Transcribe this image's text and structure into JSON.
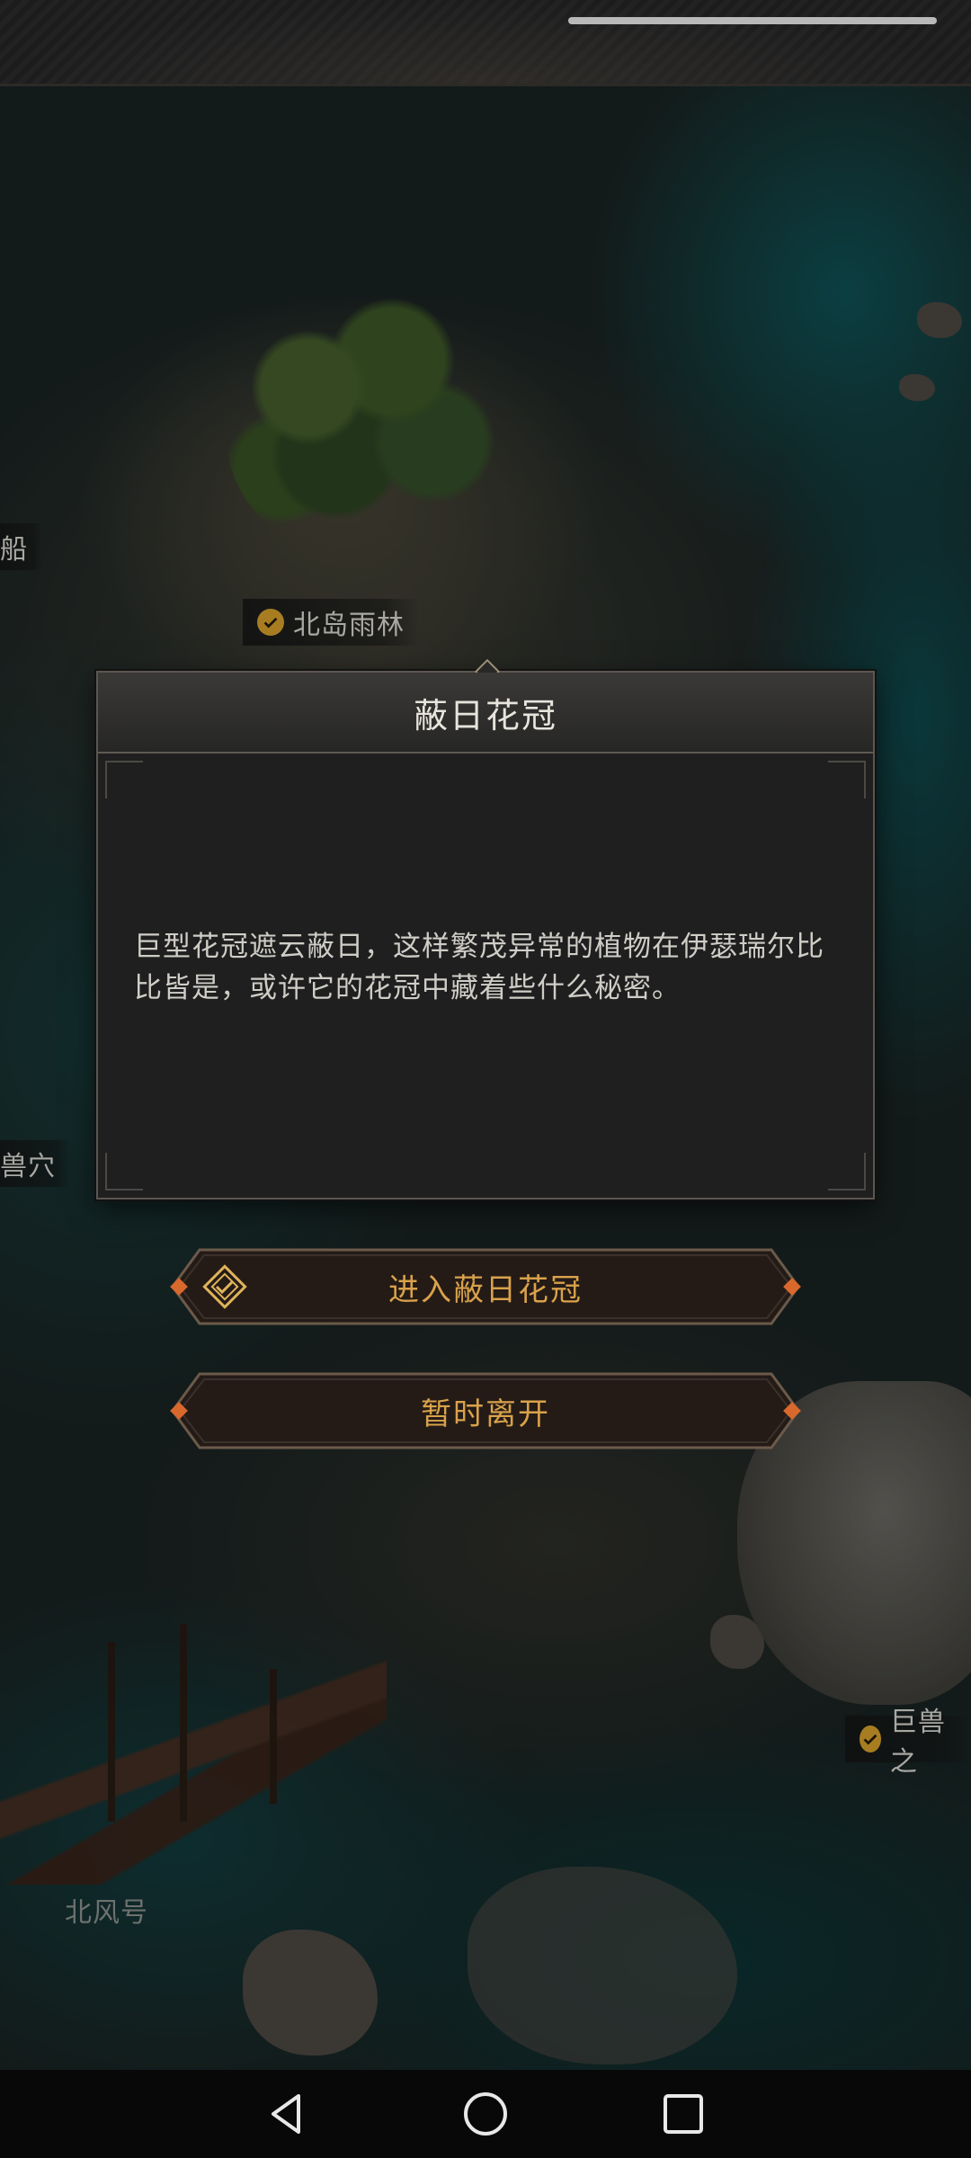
{
  "top_bar": {
    "status_indicator": "gesture-pill"
  },
  "map": {
    "labels": {
      "north_island_rainforest": "北岛雨林",
      "ship_partial": "船",
      "beast_cave_partial": "兽穴",
      "giant_beast_partial": "巨兽之",
      "north_wind": "北风号"
    }
  },
  "dialog": {
    "title": "蔽日花冠",
    "body": "巨型花冠遮云蔽日，这样繁茂异常的植物在伊瑟瑞尔比比皆是，或许它的花冠中藏着些什么秘密。"
  },
  "buttons": {
    "enter": "进入蔽日花冠",
    "leave": "暂时离开"
  },
  "nav": {
    "back": "back-icon",
    "home": "home-icon",
    "recents": "recents-icon"
  },
  "colors": {
    "accent": "#d9a24a",
    "check": "#a87d22",
    "text": "#cfcdc6"
  }
}
